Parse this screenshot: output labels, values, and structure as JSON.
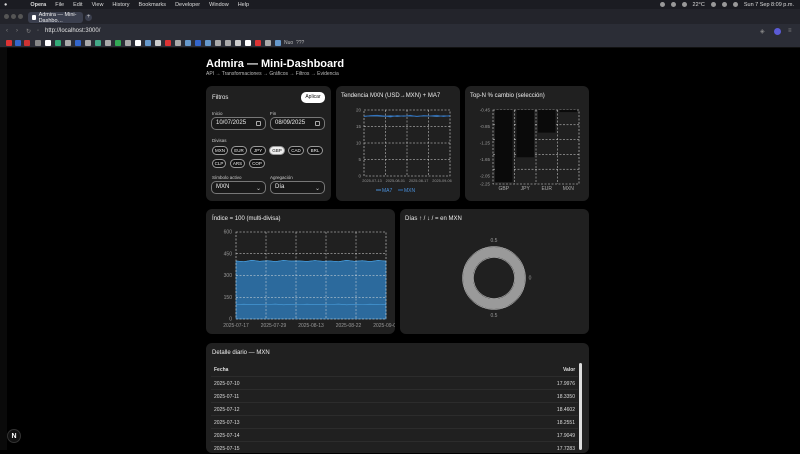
{
  "menubar": {
    "app": "Opera",
    "items": [
      "File",
      "Edit",
      "View",
      "History",
      "Bookmarks",
      "Developer",
      "Window",
      "Help"
    ],
    "status": [
      "22°C",
      "Sun 7 Sep  8:09 p.m."
    ]
  },
  "browser": {
    "tab_title": "Admira — Mini-Dashbo…",
    "new_tab": "+",
    "url": "http://localhost:3000/",
    "bookmark_label": "Nuo",
    "bookmark_extra": "???"
  },
  "header": {
    "title": "Admira — Mini-Dashboard",
    "subtitle": "API → Transformaciones → Gráficos → Filtros → Evidencia"
  },
  "filters": {
    "title": "Filtros",
    "apply": "Aplicar",
    "start_label": "Inicio",
    "start_value": "10/07/2025",
    "end_label": "Fin",
    "end_value": "08/09/2025",
    "currencies_label": "Divisas",
    "currencies": [
      {
        "code": "MXN",
        "selected": false
      },
      {
        "code": "EUR",
        "selected": false
      },
      {
        "code": "JPY",
        "selected": false
      },
      {
        "code": "GBP",
        "selected": true
      },
      {
        "code": "CAD",
        "selected": false
      },
      {
        "code": "BRL",
        "selected": false
      },
      {
        "code": "CLP",
        "selected": false
      },
      {
        "code": "ARS",
        "selected": false
      },
      {
        "code": "COP",
        "selected": false
      }
    ],
    "active_label": "Símbolo activo",
    "active_value": "MXN",
    "agg_label": "Agregación",
    "agg_value": "Día"
  },
  "trend": {
    "title": "Tendencia MXN (USD→MXN) + MA7",
    "legend": [
      "MA7",
      "MXN"
    ],
    "colors": {
      "ma7": "#4a90d9",
      "mxn": "#2f6fb8"
    }
  },
  "topn": {
    "title": "Top-N % cambio (selección)"
  },
  "index": {
    "title": "Índice = 100 (multi-divisa)",
    "color": "#2f78b4"
  },
  "days": {
    "title": "Días ↑ / ↓ / = en MXN"
  },
  "table": {
    "title": "Detalle diario — MXN",
    "headers": {
      "date": "Fecha",
      "value": "Valor"
    },
    "rows": [
      {
        "date": "2025-07-10",
        "value": "17.9976"
      },
      {
        "date": "2025-07-11",
        "value": "18.3350"
      },
      {
        "date": "2025-07-12",
        "value": "18.4602"
      },
      {
        "date": "2025-07-13",
        "value": "18.2551"
      },
      {
        "date": "2025-07-14",
        "value": "17.9049"
      },
      {
        "date": "2025-07-15",
        "value": "17.7283"
      }
    ]
  },
  "badge": "N",
  "chart_data": [
    {
      "type": "line",
      "title": "Tendencia MXN (USD→MXN) + MA7",
      "x_ticks": [
        "2025-07-13",
        "2025-08-01",
        "2025-08-17",
        "2025-09-06"
      ],
      "y_ticks": [
        0,
        5,
        10,
        15,
        20
      ],
      "ylim": [
        0,
        20
      ],
      "series": [
        {
          "name": "MA7",
          "values": [
            18.1,
            18.2,
            18.2,
            18.1,
            18.2,
            18.1,
            18.2,
            18.2,
            18.1,
            18.2,
            18.2,
            18.1,
            18.2,
            18.2
          ]
        },
        {
          "name": "MXN",
          "values": [
            18.0,
            18.3,
            18.4,
            18.2,
            17.9,
            18.3,
            18.1,
            18.4,
            18.0,
            18.3,
            18.2,
            18.4,
            18.0,
            18.3
          ]
        }
      ],
      "grid": true,
      "legend": "bottom"
    },
    {
      "type": "bar",
      "title": "Top-N % cambio (selección)",
      "categories": [
        "GBP",
        "JPY",
        "EUR",
        "MXN"
      ],
      "values": [
        -2.2,
        -1.6,
        -1.0,
        -0.5
      ],
      "y_ticks": [
        -0.45,
        -0.85,
        -1.25,
        -1.65,
        -2.05,
        -2.25
      ],
      "ylim": [
        -2.25,
        -0.45
      ],
      "grid": true
    },
    {
      "type": "area",
      "title": "Índice = 100 (multi-divisa)",
      "x_ticks": [
        "2025-07-17",
        "2025-07-29",
        "2025-08-13",
        "2025-08-22",
        "2025-09-06"
      ],
      "y_ticks": [
        0,
        150,
        300,
        450,
        600
      ],
      "ylim": [
        0,
        600
      ],
      "series": [
        {
          "values": [
            400,
            395,
            405,
            398,
            402,
            396,
            404,
            399,
            401,
            397,
            403,
            398,
            400,
            395,
            405,
            398,
            402,
            396,
            404,
            399
          ]
        },
        {
          "values": [
            100,
            102,
            99,
            101,
            100,
            103,
            98,
            101,
            100,
            102,
            99,
            101,
            100,
            103,
            98,
            101,
            100,
            102,
            99,
            101
          ]
        }
      ],
      "grid": true
    },
    {
      "type": "pie",
      "title": "Días ↑ / ↓ / = en MXN",
      "slices": [
        {
          "value": 100
        }
      ],
      "axis_labels": [
        "0.5",
        "0",
        "0.5"
      ]
    }
  ]
}
